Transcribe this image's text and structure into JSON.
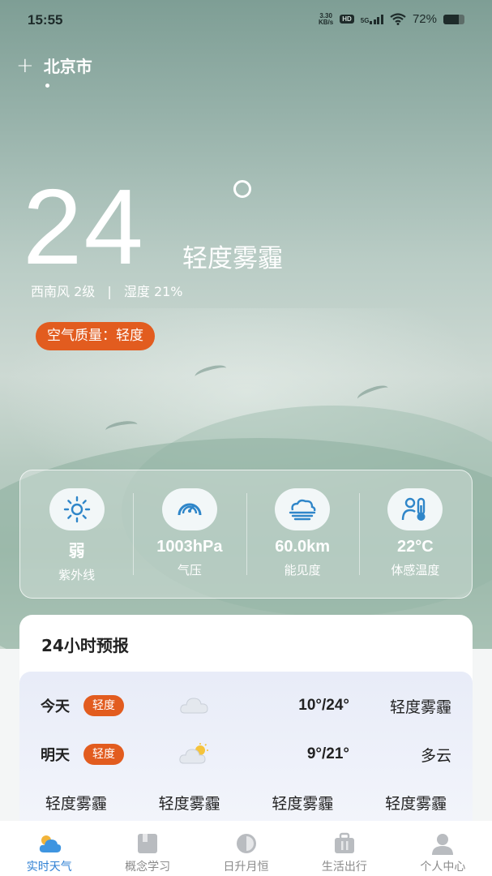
{
  "status_bar": {
    "time": "15:55",
    "net_speed_value": "3.30",
    "net_speed_unit": "KB/s",
    "hd_label": "HD",
    "network_label": "5G",
    "battery_percent": "72%",
    "battery_level": 0.72
  },
  "header": {
    "add_city_icon": "plus-icon",
    "city": "北京市"
  },
  "current": {
    "temperature": "24",
    "condition": "轻度雾霾",
    "wind": "西南风 2级",
    "humidity": "湿度 21%",
    "separator": "|",
    "air_quality": "空气质量：轻度"
  },
  "metrics": [
    {
      "icon": "sun-icon",
      "value": "弱",
      "label": "紫外线"
    },
    {
      "icon": "gauge-icon",
      "value": "1003hPa",
      "label": "气压"
    },
    {
      "icon": "fog-icon",
      "value": "60.0km",
      "label": "能见度"
    },
    {
      "icon": "thermometer-person-icon",
      "value": "22°C",
      "label": "体感温度"
    }
  ],
  "forecast": {
    "title": "24小时预报",
    "days": [
      {
        "name": "今天",
        "badge": "轻度",
        "icon": "cloud-icon",
        "temp": "10°/24°",
        "condition": "轻度雾霾"
      },
      {
        "name": "明天",
        "badge": "轻度",
        "icon": "partly-cloudy-icon",
        "temp": "9°/21°",
        "condition": "多云"
      }
    ],
    "hourly": [
      "轻度雾霾",
      "轻度雾霾",
      "轻度雾霾",
      "轻度雾霾"
    ]
  },
  "tabs": [
    {
      "label": "实时天气",
      "icon": "weather-icon",
      "active": true
    },
    {
      "label": "概念学习",
      "icon": "book-icon",
      "active": false
    },
    {
      "label": "日升月恒",
      "icon": "moon-icon",
      "active": false
    },
    {
      "label": "生活出行",
      "icon": "suitcase-icon",
      "active": false
    },
    {
      "label": "个人中心",
      "icon": "user-icon",
      "active": false
    }
  ],
  "colors": {
    "accent_orange": "#e25c1f",
    "tab_active": "#2d7fd3",
    "icon_blue": "#2f86c9"
  }
}
